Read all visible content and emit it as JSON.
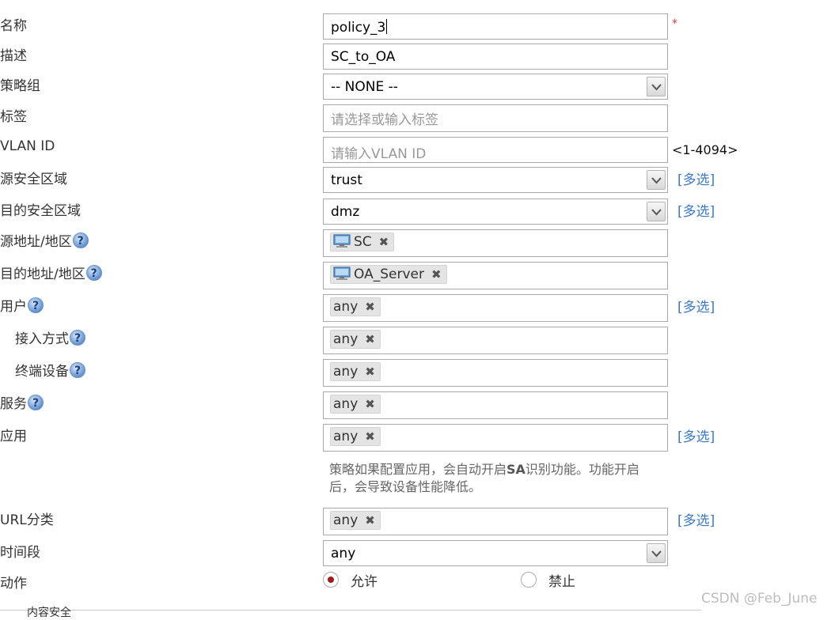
{
  "form": {
    "name": {
      "label": "名称",
      "value": "policy_3",
      "required_mark": "*"
    },
    "description": {
      "label": "描述",
      "value": "SC_to_OA"
    },
    "policy_group": {
      "label": "策略组",
      "value": "-- NONE --"
    },
    "tags": {
      "label": "标签",
      "placeholder": "请选择或输入标签"
    },
    "vlan_id": {
      "label": "VLAN ID",
      "placeholder": "请输入VLAN ID",
      "range_hint": "<1-4094>"
    },
    "source_zone": {
      "label": "源安全区域",
      "value": "trust",
      "multi_link": "[多选]"
    },
    "dest_zone": {
      "label": "目的安全区域",
      "value": "dmz",
      "multi_link": "[多选]"
    },
    "source_address": {
      "label": "源地址/地区",
      "tag": "SC"
    },
    "dest_address": {
      "label": "目的地址/地区",
      "tag": "OA_Server"
    },
    "user": {
      "label": "用户",
      "tag": "any",
      "multi_link": "[多选]"
    },
    "access_method": {
      "label": "接入方式",
      "tag": "any"
    },
    "terminal_device": {
      "label": "终端设备",
      "tag": "any"
    },
    "service": {
      "label": "服务",
      "tag": "any"
    },
    "application": {
      "label": "应用",
      "tag": "any",
      "multi_link": "[多选]",
      "note_line1_a": "策略如果配置应用，会自动开启",
      "note_line1_b": "SA",
      "note_line1_c": "识别功能。功能开启",
      "note_line2": "后，会导致设备性能降低。"
    },
    "url_category": {
      "label": "URL分类",
      "tag": "any",
      "multi_link": "[多选]"
    },
    "time_range": {
      "label": "时间段",
      "value": "any"
    },
    "action": {
      "label": "动作",
      "options": [
        "允许",
        "禁止"
      ],
      "selected": "允许"
    }
  },
  "help_glyph": "?",
  "remove_glyph": "✖",
  "icons": {
    "help": "help-icon",
    "dropdown": "chevron-down-icon",
    "remove": "close-icon",
    "address": "computer-icon"
  },
  "colors": {
    "link": "#3a78c9",
    "required": "#e23b3b",
    "radio_selected": "#a01a1a"
  },
  "watermark": "CSDN @Feb_June",
  "bottom_partial": "内容安全"
}
